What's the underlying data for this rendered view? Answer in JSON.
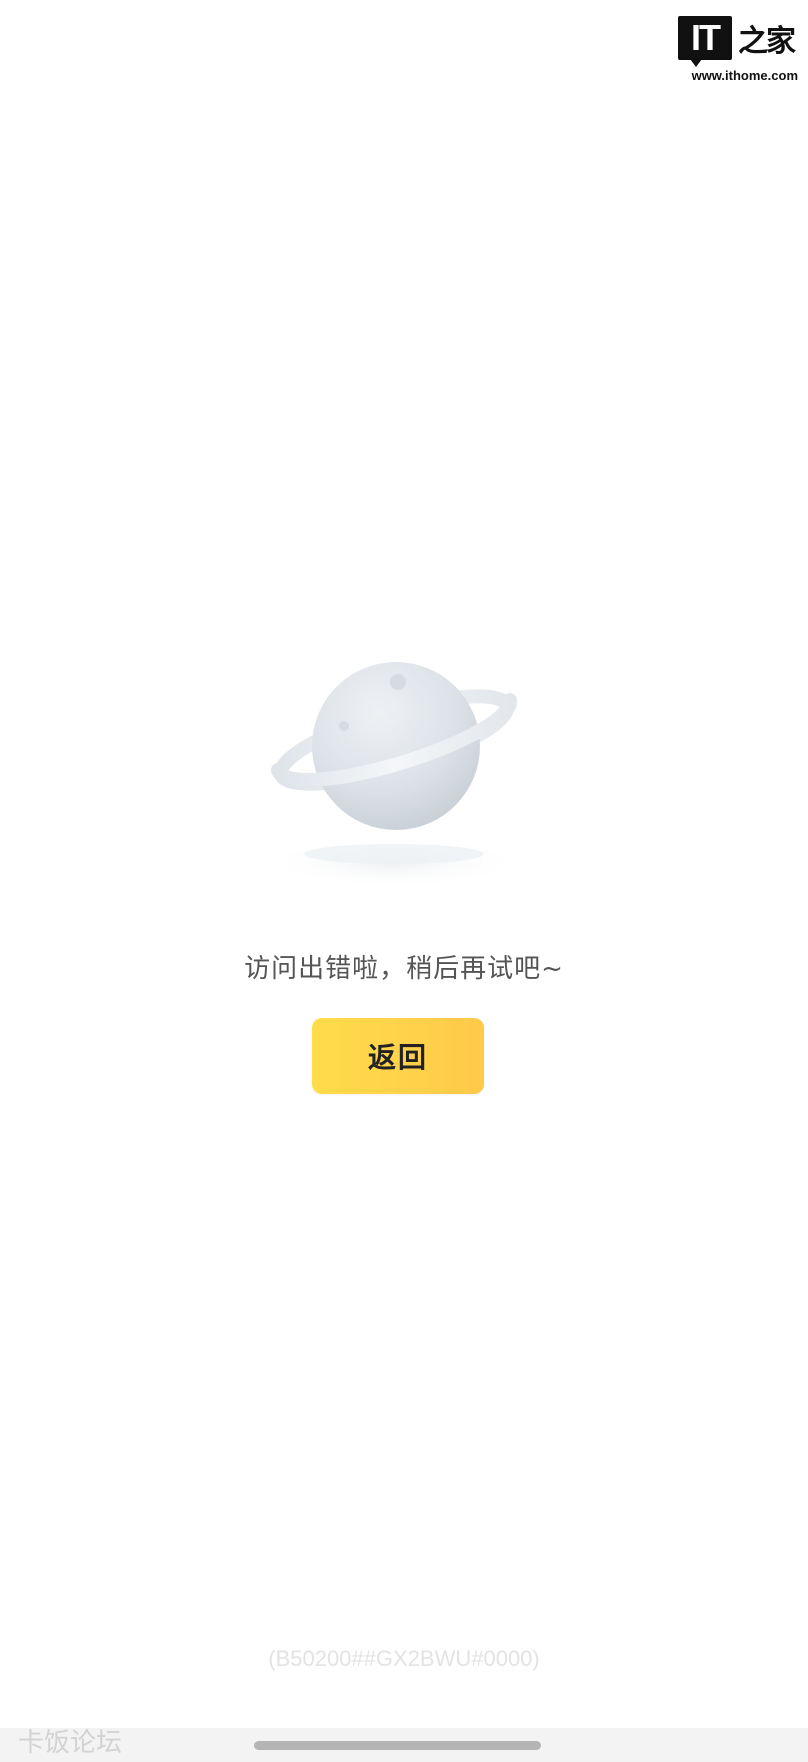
{
  "watermark": {
    "logo_text": "IT",
    "logo_chinese": "之家",
    "url": "www.ithome.com"
  },
  "illustration": {
    "icon": "planet-icon"
  },
  "error": {
    "message": "访问出错啦，稍后再试吧~",
    "code": "(B50200##GX2BWU#0000)"
  },
  "actions": {
    "back_label": "返回"
  },
  "footer": {
    "forum_watermark": "卡饭论坛"
  },
  "colors": {
    "button_start": "#ffdc4a",
    "button_end": "#ffc94a",
    "message_text": "#555555",
    "code_text": "#e3e3e3"
  }
}
